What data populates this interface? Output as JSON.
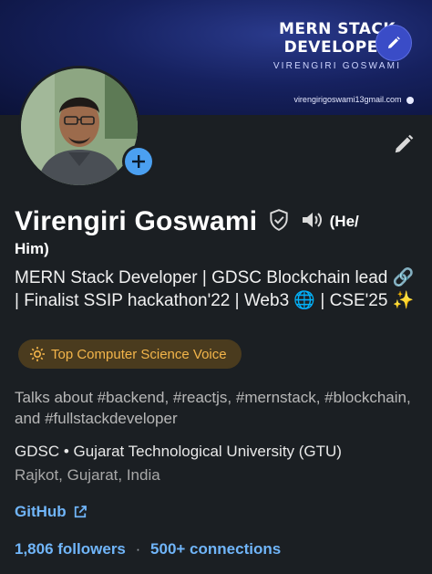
{
  "banner": {
    "title_line1": "MERN STACK",
    "title_line2": "DEVELOPER",
    "owner_name": "VIRENGIRI GOSWAMI",
    "email": "virengirigoswami13gmail.com"
  },
  "profile": {
    "name": "Virengiri Goswami",
    "pronouns_part1": "(He/",
    "pronouns_part2": "Him)",
    "headline": "MERN Stack Developer | GDSC Blockchain lead 🔗 | Finalist SSIP hackathon'22 | Web3 🌐 | CSE'25 ✨",
    "badge": "Top Computer Science Voice",
    "talks_about": "Talks about #backend, #reactjs, #mernstack, #blockchain, and #fullstackdeveloper",
    "education": "GDSC • Gujarat Technological University (GTU)",
    "location": "Rajkot, Gujarat, India",
    "link_label": "GitHub",
    "followers": "1,806 followers",
    "separator": "·",
    "connections": "500+ connections"
  },
  "colors": {
    "background": "#1b1f23",
    "accent_link": "#70b5f9",
    "badge_text": "#f3b54a",
    "add_button": "#4ba0f1"
  },
  "icons": [
    "pencil-icon",
    "plus-icon",
    "verified-shield-icon",
    "speaker-icon",
    "sparkle-icon",
    "external-link-icon"
  ]
}
